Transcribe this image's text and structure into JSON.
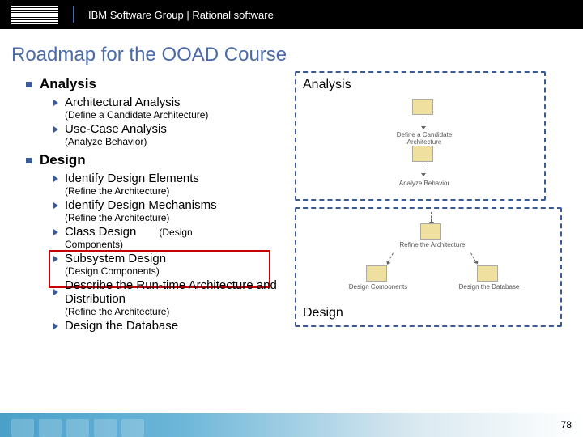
{
  "header": {
    "logo_text": "IBM",
    "title": "IBM Software Group | Rational software"
  },
  "slide_title": "Roadmap for the OOAD Course",
  "sections": {
    "analysis": {
      "heading": "Analysis",
      "items": [
        {
          "title": "Architectural Analysis",
          "sub": "(Define a Candidate Architecture)",
          "inline": ""
        },
        {
          "title": "Use-Case Analysis",
          "sub": "(Analyze Behavior)",
          "inline": ""
        }
      ]
    },
    "design": {
      "heading": "Design",
      "items": [
        {
          "title": "Identify Design Elements",
          "sub": "(Refine the Architecture)",
          "inline": ""
        },
        {
          "title": "Identify Design Mechanisms",
          "sub": "(Refine the Architecture)",
          "inline": ""
        },
        {
          "title": "Class Design",
          "sub": "Components)",
          "inline": "(Design"
        },
        {
          "title": "Subsystem Design",
          "sub": "(Design Components)",
          "inline": ""
        },
        {
          "title": "Describe the Run-time Architecture and Distribution",
          "sub": "(Refine the Architecture)",
          "inline": ""
        },
        {
          "title": "Design the Database",
          "sub": "",
          "inline": ""
        }
      ],
      "highlighted_index": 3
    }
  },
  "diagram": {
    "analysis": {
      "label": "Analysis",
      "nodes": [
        {
          "label": "Define a Candidate Architecture"
        },
        {
          "label": "Analyze Behavior"
        }
      ]
    },
    "design": {
      "label": "Design",
      "nodes": [
        {
          "label": "Refine the Architecture"
        },
        {
          "label": "Design Components"
        },
        {
          "label": "Design the Database"
        }
      ]
    }
  },
  "footer": {
    "page_number": "78"
  }
}
